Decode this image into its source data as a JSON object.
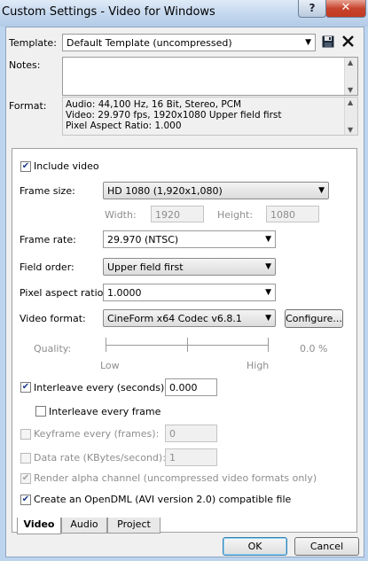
{
  "window": {
    "title": "Custom Settings - Video for Windows",
    "help_label": "?",
    "close_label": "✕"
  },
  "template": {
    "label": "Template:",
    "value": "Default Template (uncompressed)",
    "save_icon": "floppy-disk-icon",
    "delete_icon": "x-icon"
  },
  "notes": {
    "label": "Notes:",
    "value": ""
  },
  "format": {
    "label": "Format:",
    "lines": [
      "Audio: 44,100 Hz, 16 Bit, Stereo, PCM",
      "Video: 29.970 fps, 1920x1080 Upper field first",
      "Pixel Aspect Ratio: 1.000"
    ]
  },
  "video": {
    "include_video": {
      "label": "Include video",
      "checked": true
    },
    "frame_size": {
      "label": "Frame size:",
      "value": "HD 1080 (1,920x1,080)"
    },
    "width": {
      "label": "Width:",
      "value": "1920"
    },
    "height": {
      "label": "Height:",
      "value": "1080"
    },
    "frame_rate": {
      "label": "Frame rate:",
      "value": "29.970 (NTSC)"
    },
    "field_order": {
      "label": "Field order:",
      "value": "Upper field first"
    },
    "pixel_aspect_ratio": {
      "label": "Pixel aspect ratio:",
      "value": "1.0000"
    },
    "video_format": {
      "label": "Video format:",
      "value": "CineForm x64 Codec v6.8.1"
    },
    "configure_label": "Configure...",
    "quality": {
      "label": "Quality:",
      "value_text": "0.0 %",
      "low": "Low",
      "high": "High",
      "level": 0.0
    },
    "interleave_seconds": {
      "label": "Interleave every (seconds):",
      "checked": true,
      "value": "0.000"
    },
    "interleave_frame": {
      "label": "Interleave every frame",
      "checked": false
    },
    "keyframe": {
      "label": "Keyframe every (frames):",
      "checked": false,
      "value": "0"
    },
    "data_rate": {
      "label": "Data rate (KBytes/second):",
      "checked": false,
      "value": "1"
    },
    "render_alpha": {
      "label": "Render alpha channel (uncompressed video formats only)",
      "checked": true
    },
    "opendml": {
      "label": "Create an OpenDML (AVI version 2.0) compatible file",
      "checked": true
    }
  },
  "tabs": [
    {
      "label": "Video",
      "active": true
    },
    {
      "label": "Audio",
      "active": false
    },
    {
      "label": "Project",
      "active": false
    }
  ],
  "buttons": {
    "ok": "OK",
    "cancel": "Cancel"
  }
}
